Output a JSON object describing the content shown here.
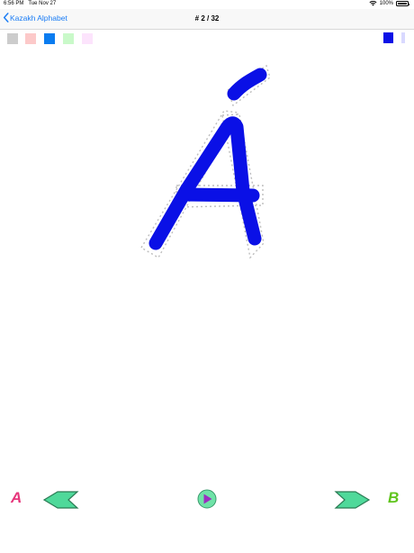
{
  "status_bar": {
    "time": "6:56 PM",
    "date": "Tue Nov 27",
    "battery": "100%",
    "wifi_icon": "wifi-icon",
    "battery_icon": "battery-icon"
  },
  "nav": {
    "back_label": "Kazakh Alphabet",
    "back_icon": "chevron-left-icon",
    "title": "# 2 / 32"
  },
  "palette": {
    "swatches": [
      {
        "name": "gray",
        "color": "#cccccc"
      },
      {
        "name": "pink",
        "color": "#fcc9c9"
      },
      {
        "name": "blue",
        "color": "#0a7cf0"
      },
      {
        "name": "light-green",
        "color": "#c9f9c9"
      },
      {
        "name": "light-pink",
        "color": "#fce4fc"
      }
    ],
    "selected_color": "#0a10e6",
    "secondary_color": "#d9d9ff"
  },
  "drawing": {
    "letter": "Á",
    "stroke_color": "#0a10e6",
    "guide_color": "#bdbdbd"
  },
  "controls": {
    "prev_letter": "A",
    "next_letter": "B",
    "prev_icon": "arrow-left-icon",
    "play_icon": "play-icon",
    "next_icon": "arrow-right-icon",
    "prev_letter_color": "#e6357b",
    "next_letter_color": "#5fc41c",
    "arrow_fill": "#4fd99a",
    "play_fill": "#9b2fc0"
  }
}
